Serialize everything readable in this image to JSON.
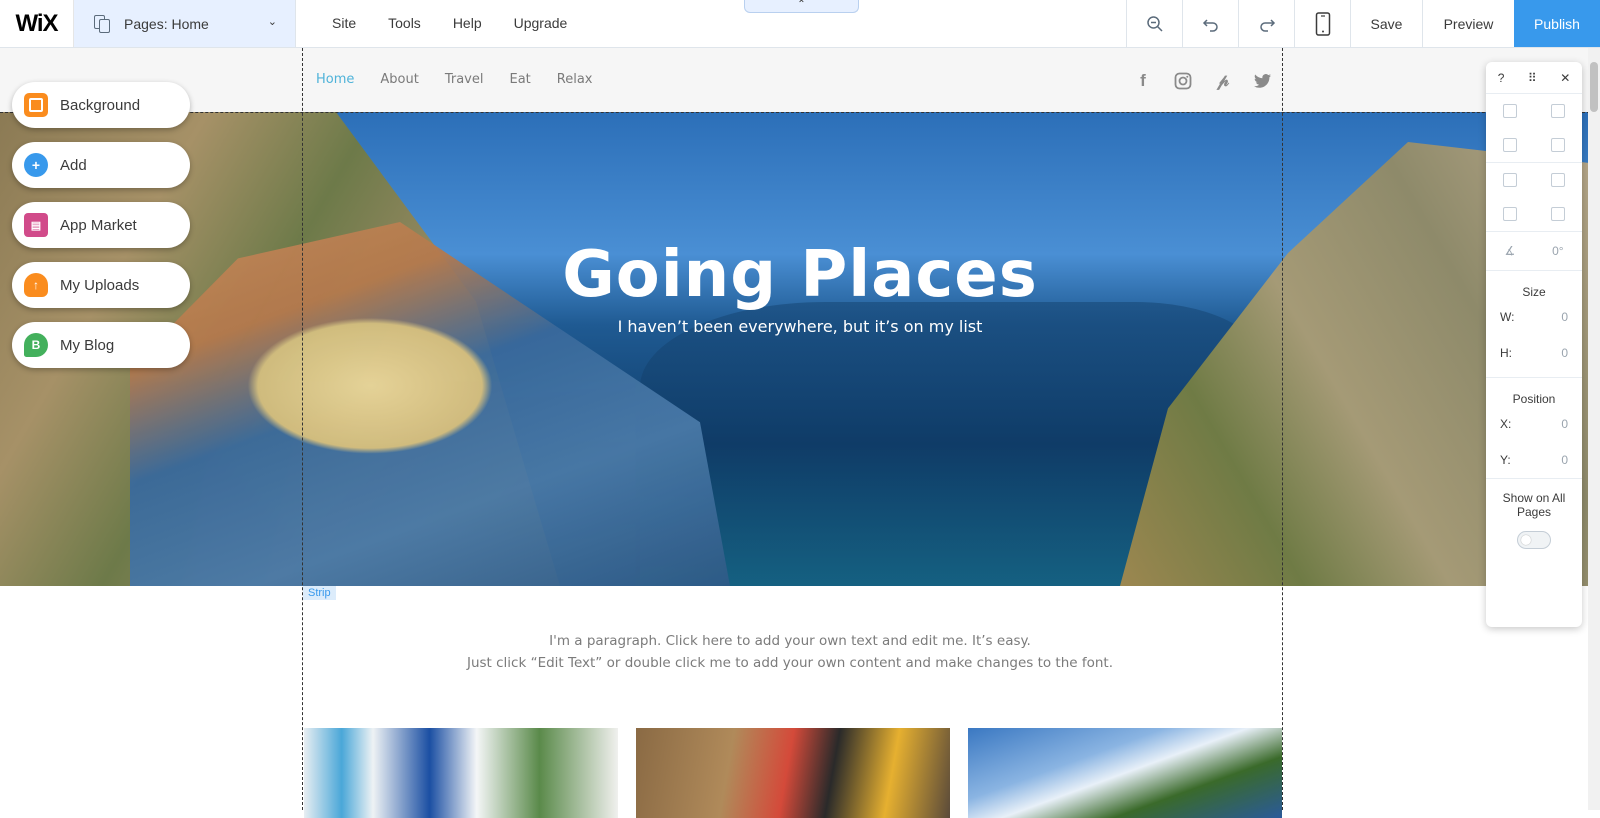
{
  "topbar": {
    "logo": "WiX",
    "pages_label": "Pages: Home",
    "menu": [
      "Site",
      "Tools",
      "Help",
      "Upgrade"
    ],
    "save": "Save",
    "preview": "Preview",
    "publish": "Publish",
    "accent": "#3899ec"
  },
  "site": {
    "nav": [
      "Home",
      "About",
      "Travel",
      "Eat",
      "Relax"
    ],
    "active_nav": "Home",
    "socials": [
      "facebook-icon",
      "instagram-icon",
      "pinterest-icon",
      "twitter-icon"
    ],
    "hero_title": "Going Places",
    "hero_subtitle": "I haven’t been everywhere, but it’s on my list",
    "strip_label": "Strip",
    "paragraph_line1": "I'm a paragraph. Click here to add your own text and edit me. It’s easy.",
    "paragraph_line2": "Just click “Edit Text” or double click me to add your own content and make changes to the font."
  },
  "left_panel": {
    "items": [
      {
        "label": "Background",
        "icon": "background-icon"
      },
      {
        "label": "Add",
        "icon": "add-icon"
      },
      {
        "label": "App Market",
        "icon": "app-market-icon"
      },
      {
        "label": "My Uploads",
        "icon": "uploads-icon"
      },
      {
        "label": "My Blog",
        "icon": "blog-icon"
      }
    ]
  },
  "inspector": {
    "help": "?",
    "rotation": "0°",
    "size_title": "Size",
    "w_label": "W:",
    "w_value": "0",
    "h_label": "H:",
    "h_value": "0",
    "position_title": "Position",
    "x_label": "X:",
    "x_value": "0",
    "y_label": "Y:",
    "y_value": "0",
    "show_all_pages": "Show on All Pages"
  }
}
